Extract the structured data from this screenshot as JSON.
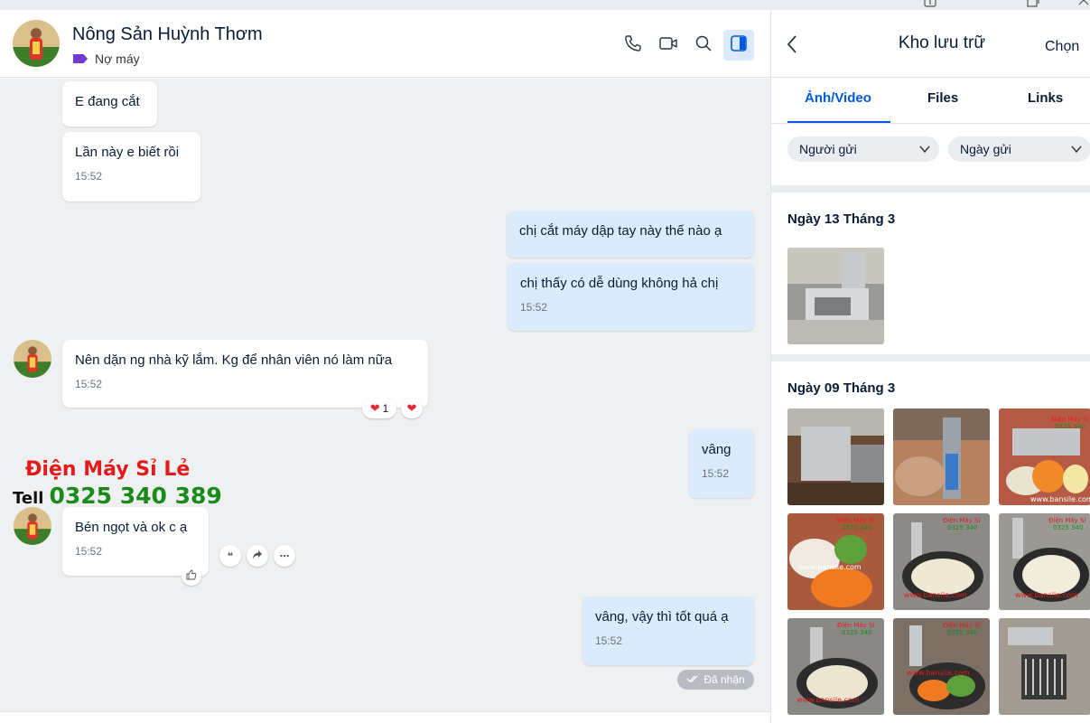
{
  "window": {
    "controls": [
      "info-icon",
      "restore-icon",
      "close-icon"
    ]
  },
  "header": {
    "name": "Nông Sản Huỳnh Thơm",
    "tag": "Nợ máy",
    "tag_color": "#6f3bd3",
    "buttons": [
      "phone-icon",
      "video-icon",
      "search-icon",
      "sidebar-toggle-icon"
    ]
  },
  "messages": [
    {
      "from": "them",
      "text": "E đang cắt",
      "time": ""
    },
    {
      "from": "them",
      "text": "Lần này e biết rồi",
      "time": "15:52"
    },
    {
      "from": "me",
      "text": "chị cắt máy dập tay này thế nào ạ",
      "time": ""
    },
    {
      "from": "me",
      "text": "chị thấy có dễ dùng không hả chị",
      "time": "15:52"
    },
    {
      "from": "them",
      "text": "Nên dặn ng nhà kỹ lắm. Kg để nhân viên nó làm nữa",
      "time": "15:52",
      "reaction_count": "1"
    },
    {
      "from": "me",
      "text": "vâng",
      "time": "15:52"
    },
    {
      "from": "them",
      "text": "Bén ngọt và ok c ạ",
      "time": "15:52"
    },
    {
      "from": "me",
      "text": "vâng, vậy thì tốt quá ạ",
      "time": "15:52"
    }
  ],
  "status": "Đã nhận",
  "watermark": {
    "title": "Điện Máy Sỉ Lẻ",
    "tell": "Tell",
    "phone": "0325 340 389"
  },
  "panel": {
    "title": "Kho lưu trữ",
    "choose": "Chọn",
    "tabs": [
      "Ảnh/Video",
      "Files",
      "Links"
    ],
    "active_tab": "Ảnh/Video",
    "filters": [
      "Người gửi",
      "Ngày gửi"
    ],
    "sections": [
      {
        "title": "Ngày 13 Tháng 3",
        "count": 1
      },
      {
        "title": "Ngày 09 Tháng 3",
        "count": 9
      }
    ],
    "thumb_caption": "www.bansile.com",
    "thumb_brand": "Điện Máy Sỉ",
    "thumb_phone": "0325 340",
    "accent": "#005ae0"
  }
}
